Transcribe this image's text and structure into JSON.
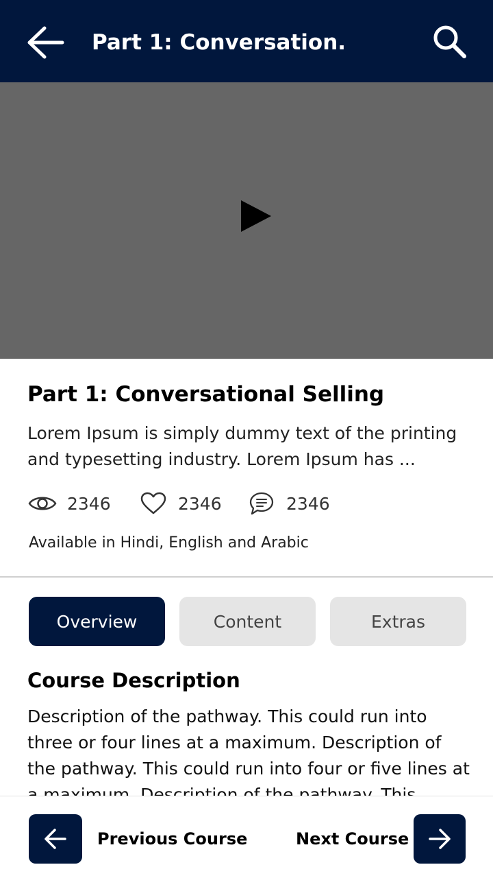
{
  "header": {
    "title": "Part 1: Conversation...",
    "back_icon": "arrow-left-icon",
    "search_icon": "search-icon",
    "background": "#01173d"
  },
  "video": {
    "play_icon": "play-icon",
    "background": "#666666"
  },
  "course": {
    "title": "Part 1: Conversational Selling",
    "summary": "Lorem Ipsum is simply dummy text of the printing and typesetting industry. Lorem Ipsum has ...",
    "stats": {
      "views": "2346",
      "likes": "2346",
      "comments": "2346"
    },
    "availability": "Available in Hindi, English and Arabic"
  },
  "tabs": [
    {
      "label": "Overview",
      "active": true
    },
    {
      "label": "Content",
      "active": false
    },
    {
      "label": "Extras",
      "active": false
    }
  ],
  "description": {
    "heading": "Course Description",
    "body": "Description of the pathway. This could run into three or four lines at a maximum. Description of the pathway. This could run into four or five lines at a maximum. Description of the pathway. This"
  },
  "footer": {
    "previous_label": "Previous Course",
    "next_label": "Next Course",
    "accent": "#01173d"
  }
}
